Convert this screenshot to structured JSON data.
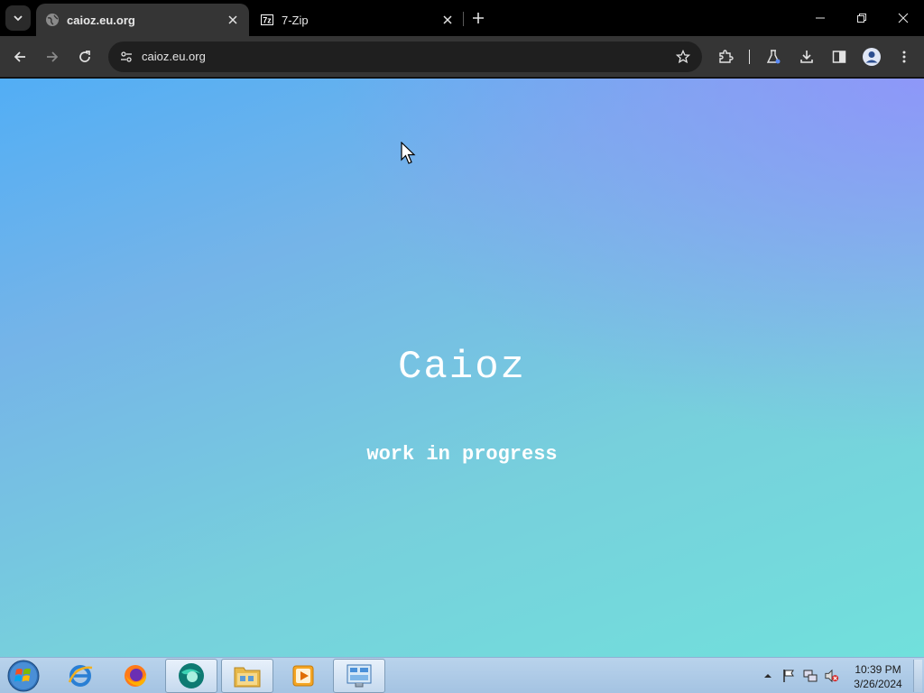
{
  "browser": {
    "tabs": [
      {
        "title": "caioz.eu.org",
        "active": true,
        "favicon": "globe-icon"
      },
      {
        "title": "7-Zip",
        "active": false,
        "favicon": "7zip-icon"
      }
    ],
    "url": "caioz.eu.org",
    "toolbar_icons": [
      "back-icon",
      "forward-icon",
      "reload-icon",
      "site-info-icon",
      "star-icon",
      "extensions-icon",
      "labs-icon",
      "download-icon",
      "side-panel-icon",
      "profile-icon",
      "menu-icon"
    ]
  },
  "page": {
    "title": "Caioz",
    "subtitle": "work in progress"
  },
  "taskbar": {
    "apps": [
      "internet-explorer-icon",
      "firefox-icon",
      "chrome-app-icon",
      "explorer-folder-icon",
      "media-player-icon",
      "control-panel-icon"
    ],
    "clock": {
      "time": "10:39 PM",
      "date": "3/26/2024"
    }
  },
  "colors": {
    "page_gradient_top": "#52aef5",
    "page_gradient_bottom": "#71e0dc",
    "page_glow": "#968cff",
    "chrome_dark": "#353535",
    "taskbar": "#b9d3ec"
  }
}
